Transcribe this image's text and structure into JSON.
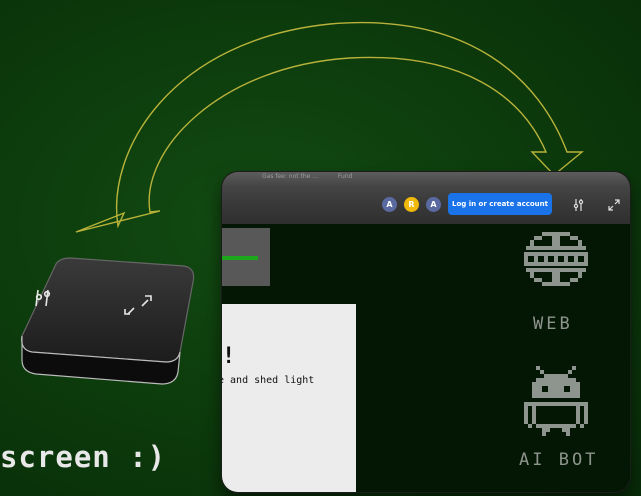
{
  "window": {
    "topbar_faded_items": [
      "Gas fee: not the ...",
      "Fund"
    ],
    "avatars": [
      {
        "letter": "A",
        "color": "#5a6aa0"
      },
      {
        "letter": "R",
        "color": "#f0b90b"
      },
      {
        "letter": "A",
        "color": "#5a6aa0"
      }
    ],
    "login_button_label": "Log in or create account",
    "panel_exclamation": "!",
    "panel_text": "e and shed light"
  },
  "sidebar_apps": [
    {
      "label": "WEB",
      "icon": "globe-icon"
    },
    {
      "label": "AI BOT",
      "icon": "android-robot-icon"
    }
  ],
  "caption": "screen :)",
  "colors": {
    "background": "#0c3a0c",
    "accent_blue": "#1a73e8",
    "arrow_outline": "#b8b23a",
    "pixel_gray": "#8e948e"
  }
}
